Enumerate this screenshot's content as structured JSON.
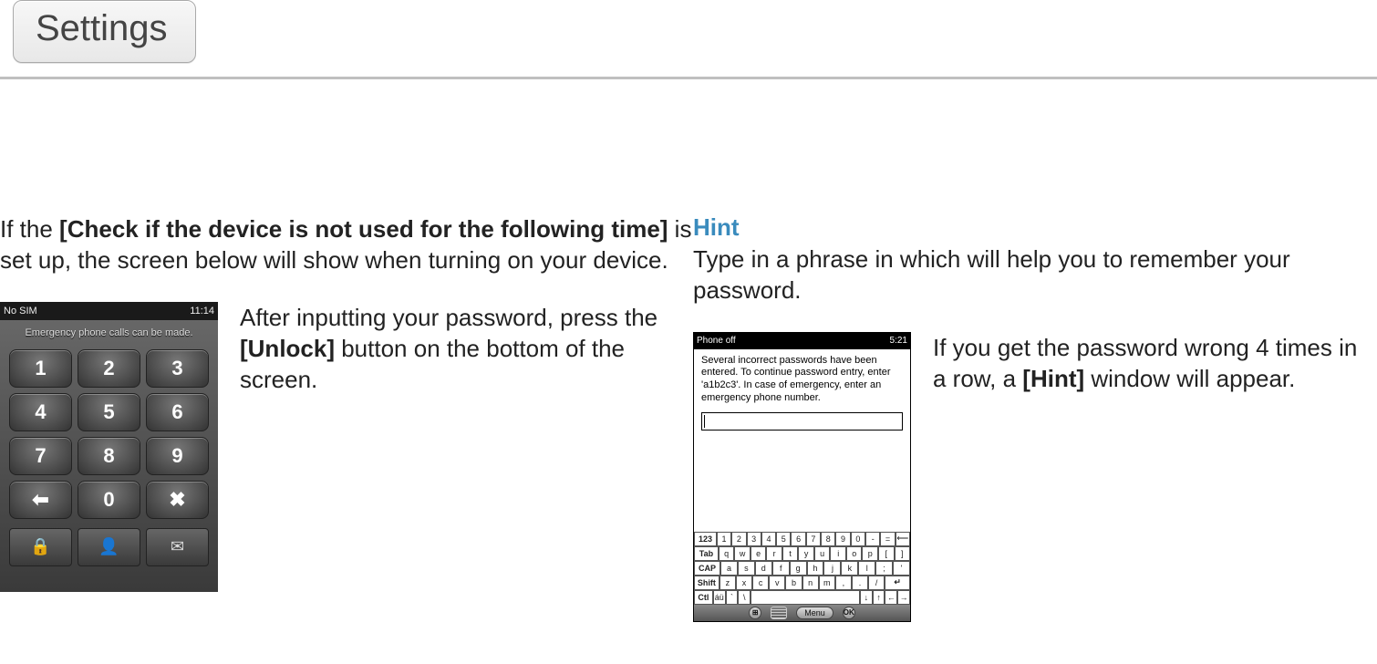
{
  "tab": {
    "label": "Settings"
  },
  "left": {
    "intro_pre": "If the ",
    "intro_bold": "[Check if the device is not used for the following time]",
    "intro_post": " is set up, the screen below will show when turning on your device.",
    "aside_pre": "After inputting your password, press the ",
    "aside_bold": "[Unlock]",
    "aside_post": " button on the bottom of the screen.",
    "phone": {
      "status_left": "No SIM",
      "status_right": "11:14",
      "msg": "Emergency phone calls can be made.",
      "keys": [
        "1",
        "2",
        "3",
        "4",
        "5",
        "6",
        "7",
        "8",
        "9",
        "",
        "0",
        ""
      ],
      "back_icon": "⬅",
      "clear_icon": "✖",
      "lock_icon": "🔒",
      "contact_icon": "👤",
      "mail_icon": "✉"
    }
  },
  "right": {
    "title": "Hint",
    "intro": "Type in a phrase in which will help you to remember your password.",
    "aside_pre": "If you get the password wrong 4 times in a row, a ",
    "aside_bold": "[Hint]",
    "aside_post": " window will appear.",
    "phone": {
      "status_left": "Phone off",
      "status_right": "5:21",
      "msg": "Several incorrect passwords have been entered. To continue password entry, enter 'a1b2c3'. In case of emergency, enter an emergency phone number.",
      "kb_rows": {
        "r1_lead": "123",
        "r1": [
          "1",
          "2",
          "3",
          "4",
          "5",
          "6",
          "7",
          "8",
          "9",
          "0",
          "-",
          "="
        ],
        "r1_tail": "⟵",
        "r2_lead": "Tab",
        "r2": [
          "q",
          "w",
          "e",
          "r",
          "t",
          "y",
          "u",
          "i",
          "o",
          "p",
          "[",
          "]"
        ],
        "r3_lead": "CAP",
        "r3": [
          "a",
          "s",
          "d",
          "f",
          "g",
          "h",
          "j",
          "k",
          "l",
          ";",
          "'"
        ],
        "r4_lead": "Shift",
        "r4": [
          "z",
          "x",
          "c",
          "v",
          "b",
          "n",
          "m",
          ",",
          ".",
          "/"
        ],
        "r4_tail": "↵",
        "r5_lead": "Ctl",
        "r5_a": "áü",
        "r5_b": "`",
        "r5_c": "\\",
        "r5_arrows": [
          "↓",
          "↑",
          "←",
          "→"
        ]
      },
      "menu_label": "Menu",
      "ok_label": "OK"
    }
  }
}
